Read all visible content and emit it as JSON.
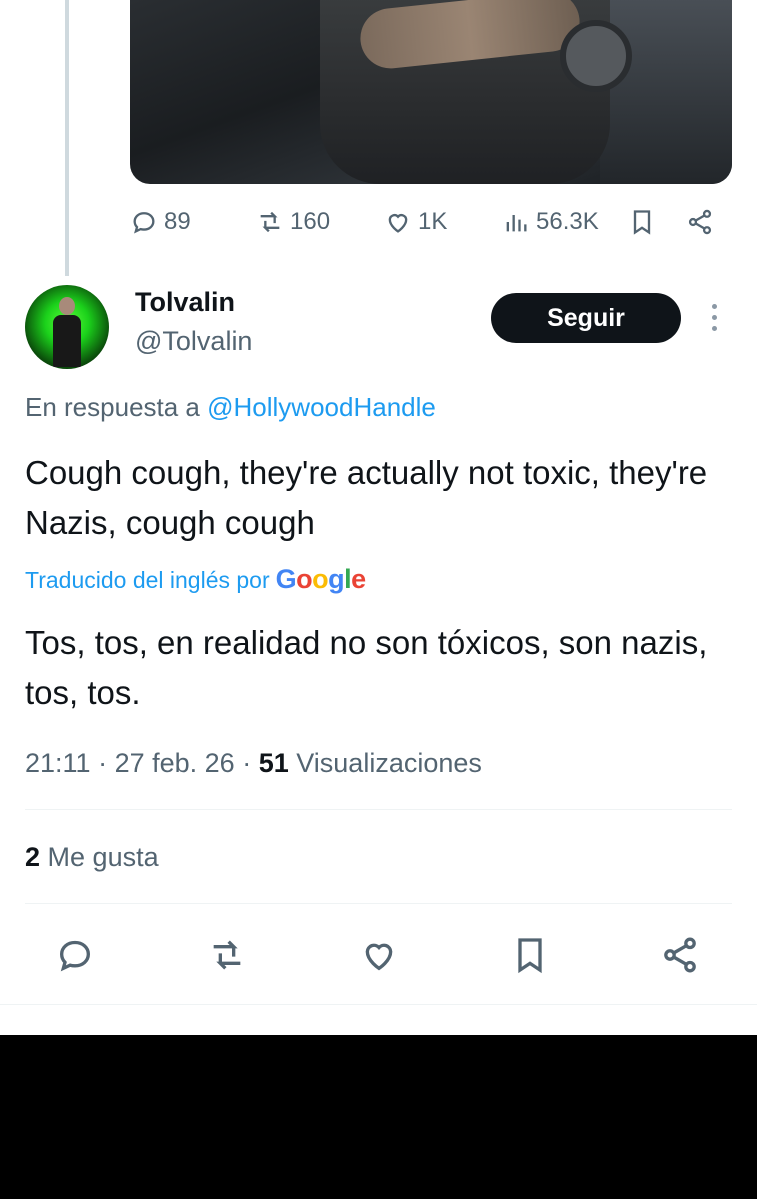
{
  "previous_tweet": {
    "stats": {
      "replies": "89",
      "reposts": "160",
      "likes": "1K",
      "views": "56.3K"
    }
  },
  "tweet": {
    "username": "Tolvalin",
    "handle": "@Tolvalin",
    "follow_label": "Seguir",
    "reply_prefix": "En respuesta a",
    "reply_to": "@HollywoodHandle",
    "text": "Cough cough, they're actually not toxic, they're Nazis, cough cough",
    "translated_by": "Traducido del inglés por",
    "translation_provider": "Google",
    "translated_text": "Tos, tos, en realidad no son tóxicos, son nazis, tos, tos.",
    "time": "21:11",
    "date": "27 feb. 26",
    "views_count": "51",
    "views_label": "Visualizaciones",
    "likes_count": "2",
    "likes_label": "Me gusta"
  },
  "icons": {
    "reply": "reply-icon",
    "repost": "repost-icon",
    "like": "heart-icon",
    "views": "views-icon",
    "bookmark": "bookmark-icon",
    "share": "share-icon",
    "more": "more-vertical-icon"
  },
  "colors": {
    "accent": "#1d9bf0",
    "secondary_text": "#536471",
    "primary_text": "#0f1419",
    "follow_button_bg": "#0f1419"
  }
}
